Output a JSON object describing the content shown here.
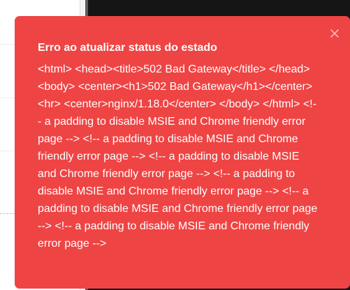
{
  "toast": {
    "title": "Erro ao atualizar status do estado",
    "message": "<html> <head><title>502 Bad Gateway</title> </head> <body> <center><h1>502 Bad Gateway</h1></center> <hr> <center>nginx/1.18.0</center> </body> </html> <!-- a padding to disable MSIE and Chrome friendly error page --> <!-- a padding to disable MSIE and Chrome friendly error page --> <!-- a padding to disable MSIE and Chrome friendly error page --> <!-- a padding to disable MSIE and Chrome friendly error page --> <!-- a padding to disable MSIE and Chrome friendly error page --> <!-- a padding to disable MSIE and Chrome friendly error page -->",
    "close_icon": "close-icon",
    "background_color": "#ef4444",
    "text_color": "#ffffff"
  }
}
